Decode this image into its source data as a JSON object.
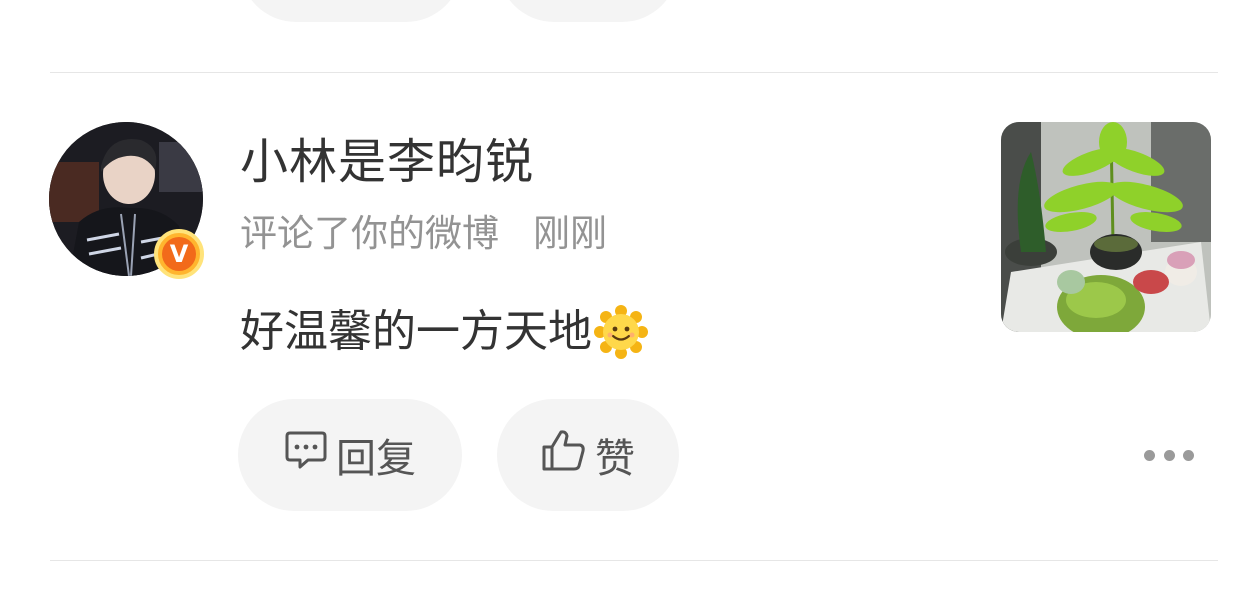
{
  "notification": {
    "username": "小林是李昀锐",
    "action": "评论了你的微博",
    "time": "刚刚",
    "comment_text": "好温馨的一方天地",
    "comment_emoji": "sun-smile-emoji",
    "verified_badge": "V"
  },
  "actions": {
    "reply_label": "回复",
    "like_label": "赞"
  },
  "icons": {
    "reply": "comment-bubble-icon",
    "like": "thumbs-up-icon",
    "more": "more-dots-icon"
  },
  "colors": {
    "badge_orange": "#f26a1a",
    "badge_ring": "#ffb52e",
    "muted_text": "#939393",
    "pill_bg": "#f4f4f4"
  }
}
